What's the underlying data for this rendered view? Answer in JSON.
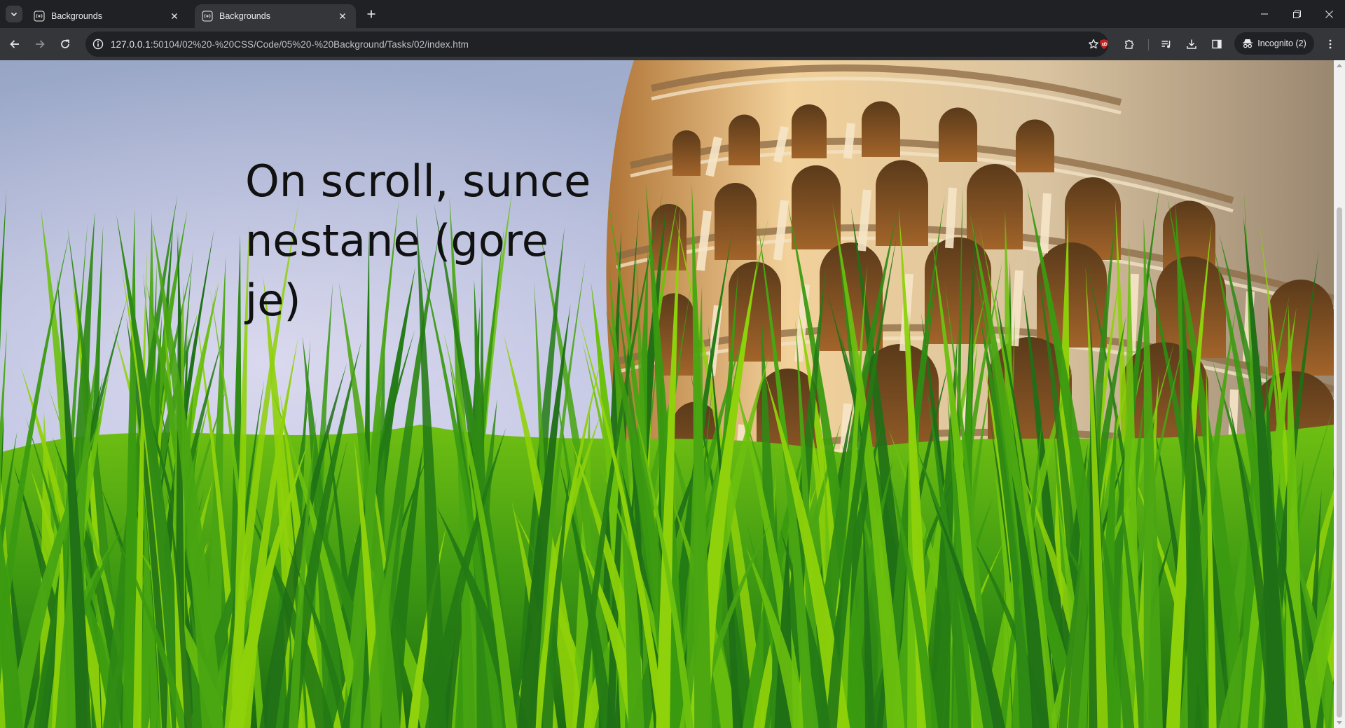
{
  "browser": {
    "tabs": [
      {
        "title": "Backgrounds",
        "active": false
      },
      {
        "title": "Backgrounds",
        "active": true
      }
    ],
    "url": {
      "host": "127.0.0.1",
      "rest": ":50104/02%20-%20CSS/Code/05%20-%20Background/Tasks/02/index.htm"
    },
    "profile_label": "Incognito (2)",
    "icons": {
      "tab_search": "chevron-down-icon",
      "favicon": "broadcast-icon",
      "close": "close-icon",
      "new_tab": "plus-icon",
      "back": "arrow-left-icon",
      "forward": "arrow-right-icon",
      "reload": "reload-icon",
      "site_info": "info-icon",
      "bookmark": "star-icon",
      "ublock": "ublock-origin-icon",
      "extensions": "puzzle-icon",
      "media": "media-queue-icon",
      "downloads": "download-icon",
      "side_panel": "side-panel-icon",
      "incognito": "incognito-icon",
      "menu": "kebab-menu-icon"
    },
    "colors": {
      "frame": "#202124",
      "toolbar": "#35363a",
      "text": "#e8eaed",
      "ublock_red": "#c5221f"
    }
  },
  "page": {
    "headline": "On scroll, sunce nestane (gore je)",
    "colors": {
      "sky_top": "#9aa8c8",
      "sky_bottom": "#c9cde6",
      "grass_dark": "#1f6f16",
      "grass_light": "#8fd10a",
      "tower_stone": "#d9c3a0"
    }
  }
}
